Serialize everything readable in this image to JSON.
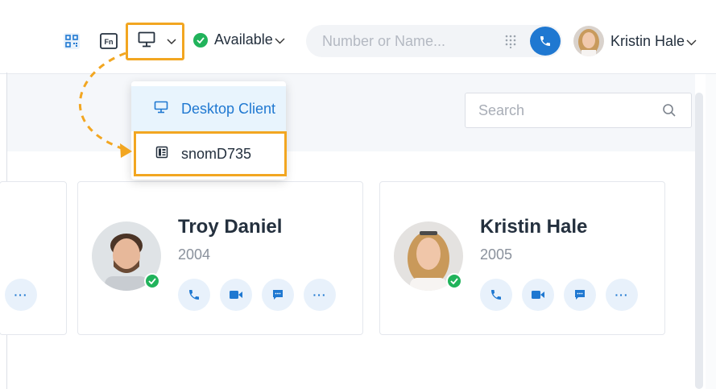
{
  "topbar": {
    "qr_icon": "qr-code-icon",
    "fn_label": "Fn",
    "device_icon": "monitor-icon",
    "status_label": "Available",
    "status_color": "#21b35b",
    "dial_placeholder": "Number or Name...",
    "user_name": "Kristin Hale",
    "accent": "#1f78d1"
  },
  "dropdown": {
    "items": [
      {
        "label": "Desktop Client",
        "icon": "monitor-icon",
        "selected": true
      },
      {
        "label": "snomD735",
        "icon": "desk-phone-icon",
        "selected": false
      }
    ]
  },
  "search": {
    "placeholder": "Search"
  },
  "contacts": [
    {
      "name": "Troy Daniel",
      "ext": "2004",
      "status": "available"
    },
    {
      "name": "Kristin Hale",
      "ext": "2005",
      "status": "available"
    }
  ],
  "highlight_color": "#f2a621"
}
